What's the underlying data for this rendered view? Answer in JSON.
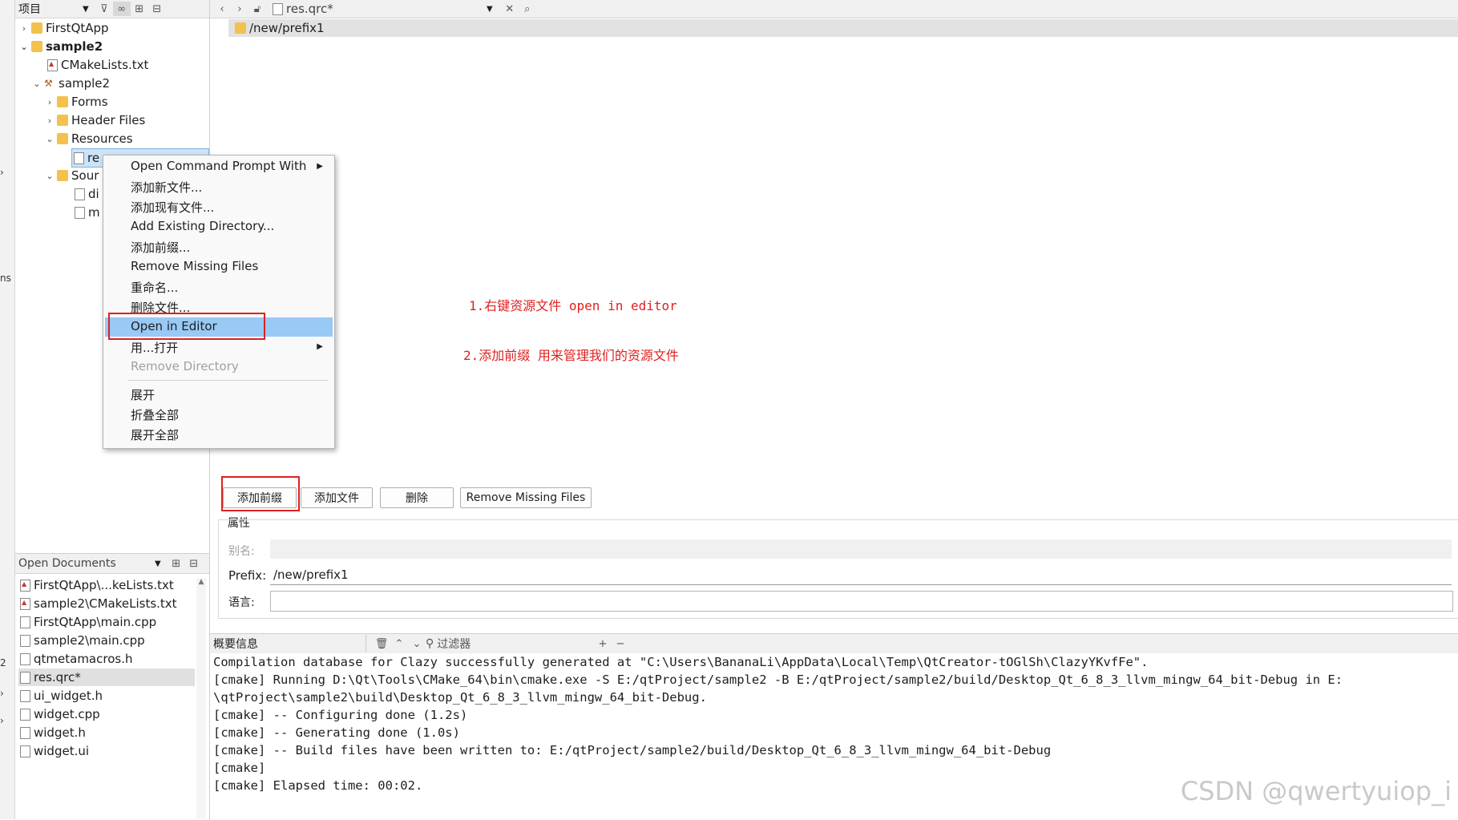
{
  "left_strip": {
    "labels": [
      "›",
      "ns",
      "2",
      "›",
      "›"
    ]
  },
  "project_panel": {
    "header": {
      "title": "项目"
    },
    "tree": [
      {
        "label": "FirstQtApp"
      },
      {
        "label": "sample2"
      },
      {
        "label": "CMakeLists.txt"
      },
      {
        "label": "sample2"
      },
      {
        "label": "Forms"
      },
      {
        "label": "Header Files"
      },
      {
        "label": "Resources"
      },
      {
        "label": "re"
      },
      {
        "label": "Sour"
      },
      {
        "label": "di"
      },
      {
        "label": "m"
      }
    ]
  },
  "editor_bar": {
    "file_name": "res.qrc*",
    "prefix_row": "/new/prefix1"
  },
  "context_menu": {
    "items": [
      "Open Command Prompt With",
      "添加新文件...",
      "添加现有文件...",
      "Add Existing Directory...",
      "添加前缀...",
      "Remove Missing Files",
      "重命名...",
      "删除文件...",
      "Open in Editor",
      "用...打开",
      "Remove Directory",
      "展开",
      "折叠全部",
      "展开全部"
    ]
  },
  "annotations": {
    "note1": "1.右键资源文件 open in editor",
    "note2": "2.添加前缀 用来管理我们的资源文件"
  },
  "buttons": {
    "add_prefix": "添加前缀",
    "add_file": "添加文件",
    "delete": "删除",
    "remove_missing": "Remove Missing Files"
  },
  "properties": {
    "title": "属性",
    "alias_label": "别名:",
    "prefix_label": "Prefix:",
    "prefix_value": "/new/prefix1",
    "lang_label": "语言:"
  },
  "open_documents": {
    "title": "Open Documents",
    "items": [
      "FirstQtApp\\...keLists.txt",
      "sample2\\CMakeLists.txt",
      "FirstQtApp\\main.cpp",
      "sample2\\main.cpp",
      "qtmetamacros.h",
      "res.qrc*",
      "ui_widget.h",
      "widget.cpp",
      "widget.h",
      "widget.ui"
    ]
  },
  "output_panel": {
    "title": "概要信息",
    "filter_placeholder": "过滤器",
    "lines": [
      "Compilation database for Clazy successfully generated at \"C:\\Users\\BananaLi\\AppData\\Local\\Temp\\QtCreator-tOGlSh\\ClazyYKvfFe\".",
      "[cmake] Running D:\\Qt\\Tools\\CMake_64\\bin\\cmake.exe -S E:/qtProject/sample2 -B E:/qtProject/sample2/build/Desktop_Qt_6_8_3_llvm_mingw_64_bit-Debug in E:",
      "\\qtProject\\sample2\\build\\Desktop_Qt_6_8_3_llvm_mingw_64_bit-Debug.",
      "[cmake] -- Configuring done (1.2s)",
      "[cmake] -- Generating done (1.0s)",
      "[cmake] -- Build files have been written to: E:/qtProject/sample2/build/Desktop_Qt_6_8_3_llvm_mingw_64_bit-Debug",
      "[cmake]",
      "[cmake] Elapsed time: 00:02."
    ]
  },
  "watermark": "CSDN @qwertyuiop_i",
  "colors": {
    "annotation_red": "#e02020",
    "menu_highlight": "#99c9f5",
    "selection": "#cce4f7"
  }
}
